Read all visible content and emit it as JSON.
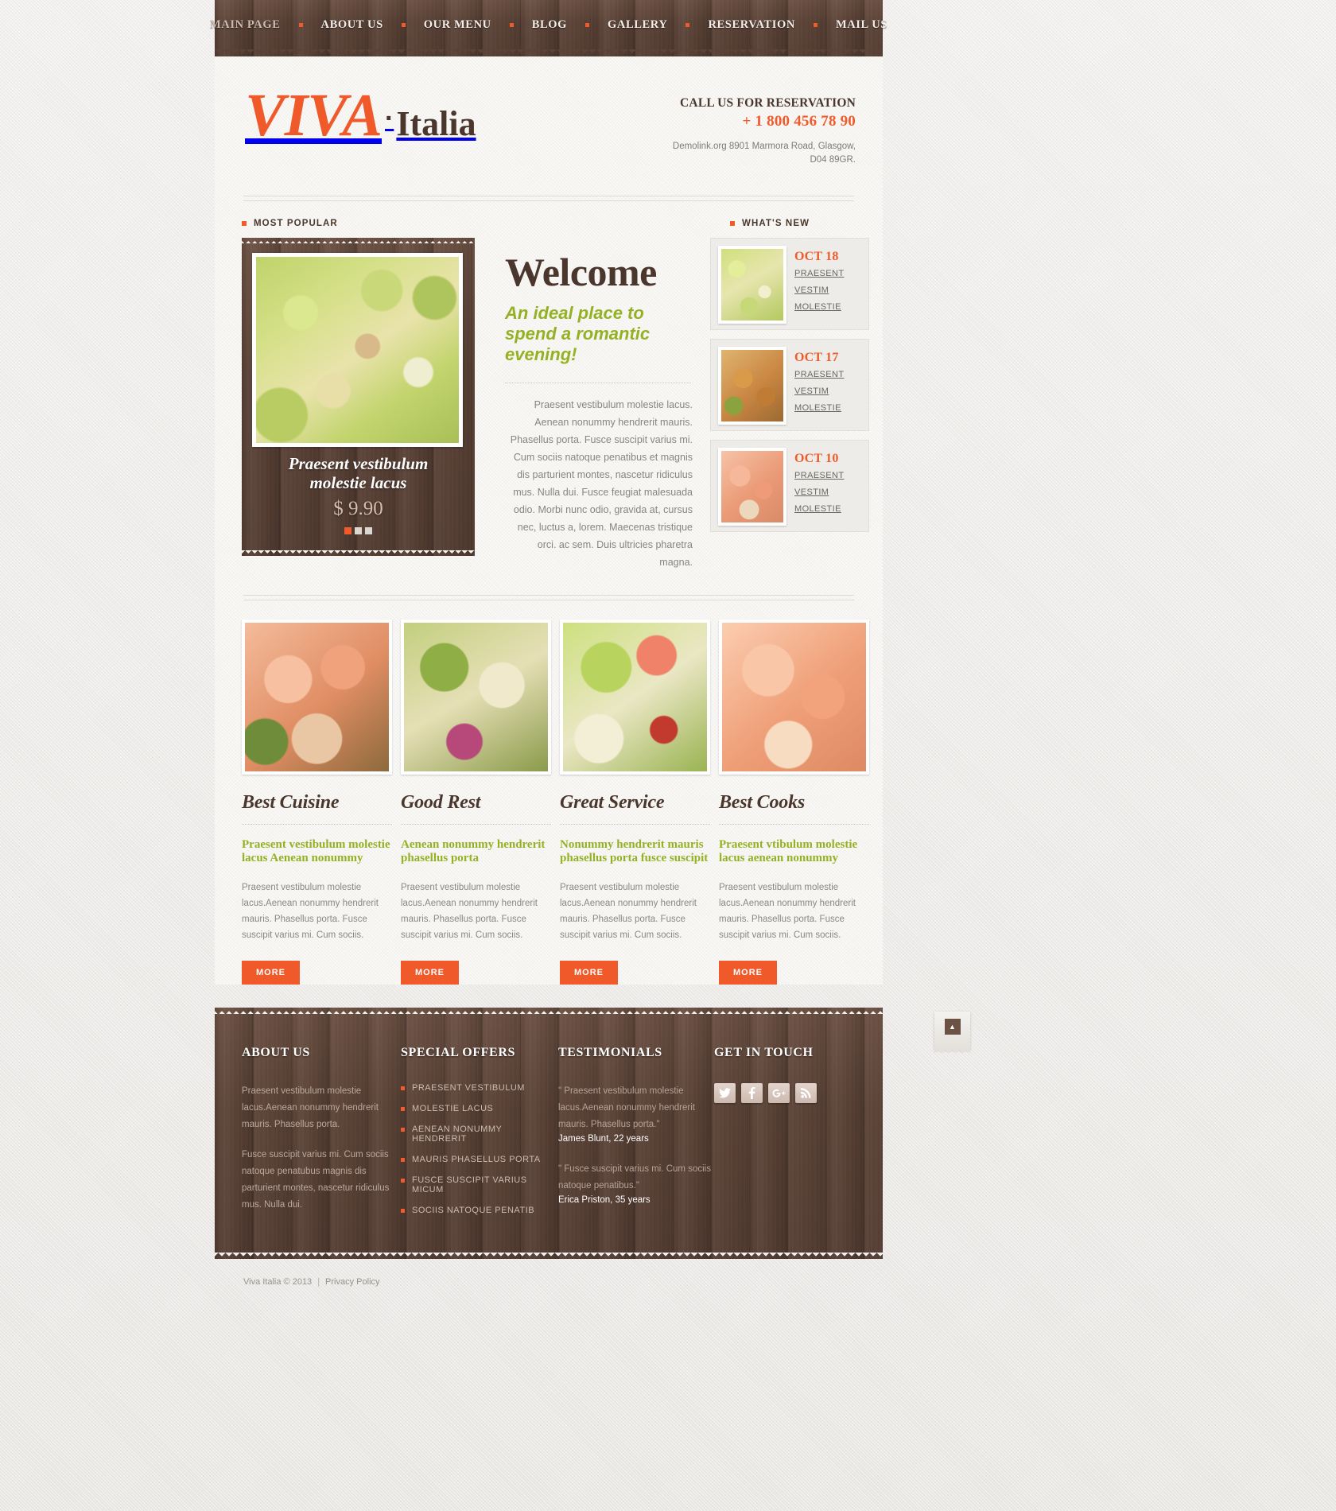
{
  "nav": {
    "items": [
      {
        "label": "MAIN PAGE",
        "active": true
      },
      {
        "label": "ABOUT US",
        "active": false
      },
      {
        "label": "OUR MENU",
        "active": false
      },
      {
        "label": "BLOG",
        "active": false
      },
      {
        "label": "GALLERY",
        "active": false
      },
      {
        "label": "RESERVATION",
        "active": false
      },
      {
        "label": "MAIL US",
        "active": false
      }
    ]
  },
  "logo": {
    "primary": "VIVA",
    "separator": "·",
    "secondary": "Italia"
  },
  "contact": {
    "call_label": "CALL US FOR RESERVATION",
    "phone": "+ 1 800 456 78 90",
    "address_line1": "Demolink.org  8901 Marmora Road, Glasgow,",
    "address_line2": "D04 89GR."
  },
  "sections": {
    "most_popular": "MOST POPULAR",
    "whats_new": "WHAT'S NEW"
  },
  "slider": {
    "caption_line1": "Praesent vestibulum",
    "caption_line2": "molestie lacus",
    "price": "$ 9.90",
    "slides": 3,
    "active_slide": 1
  },
  "welcome": {
    "title": "Welcome",
    "subtitle": "An ideal place to spend a romantic evening!",
    "body": "Praesent vestibulum molestie lacus. Aenean nonummy hendrerit mauris. Phasellus porta. Fusce suscipit varius mi. Cum sociis natoque penatibus et magnis dis parturient montes, nascetur ridiculus mus. Nulla dui. Fusce feugiat malesuada odio. Morbi nunc odio, gravida at, cursus nec, luctus a, lorem. Maecenas tristique orci. ac sem. Duis ultricies pharetra magna."
  },
  "news": [
    {
      "date": "OCT 18",
      "link_line1": "PRAESENT",
      "link_line2": "VESTIM",
      "link_line3": "MOLESTIE",
      "image": "salad-image"
    },
    {
      "date": "OCT 17",
      "link_line1": "PRAESENT",
      "link_line2": "VESTIM",
      "link_line3": "MOLESTIE",
      "image": "chicken-image"
    },
    {
      "date": "OCT 10",
      "link_line1": "PRAESENT",
      "link_line2": "VESTIM",
      "link_line3": "MOLESTIE",
      "image": "shrimp-image"
    }
  ],
  "features": [
    {
      "title": "Best Cuisine",
      "heading": "Praesent vestibulum molestie lacus Aenean nonummy",
      "body": "Praesent vestibulum molestie lacus.Aenean nonummy hendrerit mauris. Phasellus porta. Fusce suscipit varius mi. Cum sociis.",
      "button": "MORE",
      "image": "shrimp-skewer-image"
    },
    {
      "title": "Good Rest",
      "heading": "Aenean nonummy hendrerit phasellus porta",
      "body": "Praesent vestibulum molestie lacus.Aenean nonummy hendrerit mauris. Phasellus porta. Fusce suscipit varius mi. Cum sociis.",
      "button": "MORE",
      "image": "grilled-vegetables-image"
    },
    {
      "title": "Great Service",
      "heading": "Nonummy hendrerit mauris phasellus porta fusce suscipit",
      "body": "Praesent vestibulum molestie lacus.Aenean nonummy hendrerit mauris. Phasellus porta. Fusce suscipit varius mi. Cum sociis.",
      "button": "MORE",
      "image": "green-salad-image"
    },
    {
      "title": "Best Cooks",
      "heading": "Praesent vtibulum molestie lacus aenean nonummy",
      "body": "Praesent vestibulum molestie lacus.Aenean nonummy hendrerit mauris. Phasellus porta. Fusce suscipit varius mi. Cum sociis.",
      "button": "MORE",
      "image": "shrimp-dish-image"
    }
  ],
  "footer": {
    "about": {
      "title": "ABOUT US",
      "p1": "Praesent vestibulum molestie lacus.Aenean nonummy hendrerit mauris. Phasellus porta.",
      "p2": "Fusce suscipit varius mi. Cum sociis natoque penatubus magnis dis parturient montes, nascetur ridiculus mus. Nulla dui."
    },
    "offers": {
      "title": "SPECIAL OFFERS",
      "items": [
        "PRAESENT VESTIBULUM",
        "MOLESTIE LACUS",
        "AENEAN NONUMMY HENDRERIT",
        "MAURIS PHASELLUS PORTA",
        "FUSCE SUSCIPIT VARIUS MICUM",
        "SOCIIS NATOQUE PENATIB"
      ]
    },
    "testimonials": {
      "title": "TESTIMONIALS",
      "items": [
        {
          "quote": "\" Praesent vestibulum molestie lacus.Aenean nonummy hendrerit mauris. Phasellus porta.\"",
          "author": "James Blunt, 22 years"
        },
        {
          "quote": "\" Fusce suscipit varius mi. Cum sociis natoque penatibus.\"",
          "author": "Erica Priston, 35 years"
        }
      ]
    },
    "get_in_touch": {
      "title": "GET IN TOUCH",
      "socials": [
        "twitter-icon",
        "facebook-icon",
        "google-plus-icon",
        "rss-icon"
      ]
    }
  },
  "copyright": {
    "text": "Viva Italia © 2013",
    "separator": "|",
    "privacy": "Privacy Policy"
  },
  "to_top": {
    "label": "▲"
  },
  "colors": {
    "accent": "#ef5b2b",
    "green": "#94b123",
    "wood": "#5b4236",
    "dark_text": "#4a362c"
  }
}
